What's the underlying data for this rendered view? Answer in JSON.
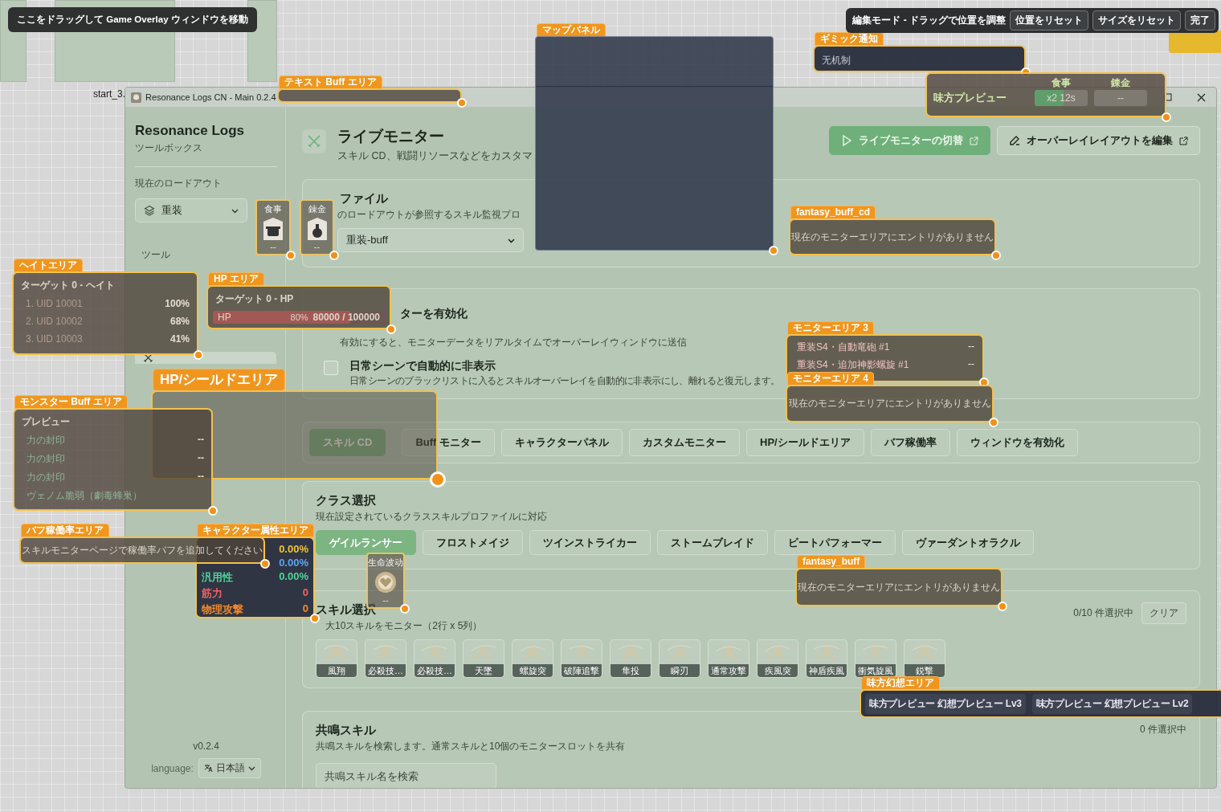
{
  "desktop": {
    "hint": "ここをドラッグして Game Overlay ウィンドウを移動",
    "thumbnail_label": "start_3."
  },
  "edit_bar": {
    "label": "編集モード - ドラッグで位置を調整",
    "buttons": [
      "位置をリセット",
      "サイズをリセット",
      "完了"
    ]
  },
  "window": {
    "title": "Resonance Logs CN - Main 0.2.4"
  },
  "sidebar": {
    "app_name": "Resonance Logs",
    "subtitle": "ツールボックス",
    "loadout_label": "現在のロードアウト",
    "loadout": "重装",
    "section": "ツール",
    "active_item": {
      "selected": true
    },
    "version": "v0.2.4",
    "language_label": "language:",
    "language": "日本語"
  },
  "header": {
    "title": "ライブモニター",
    "subtitle": "スキル CD、戦闘リソースなどをカスタマ",
    "buttons": [
      {
        "label": "ライブモニターの切替",
        "kind": "primary"
      },
      {
        "label": "オーバーレイレイアウトを編集",
        "kind": "secondary"
      }
    ]
  },
  "profile": {
    "title": "ファイル",
    "description": "のロードアウトが参照するスキル監視プロ",
    "selected": "重装-buff"
  },
  "enable_monitor": {
    "title": "ターを有効化",
    "description": "有効にすると、モニターデータをリアルタイムでオーバーレイウィンドウに送信"
  },
  "auto_hide": {
    "title": "日常シーンで自動的に非表示",
    "description": "日常シーンのブラックリストに入るとスキルオーバーレイを自動的に非表示にし、離れると復元します。",
    "checked": false
  },
  "tabs": [
    {
      "label": "スキル CD",
      "selected": true
    },
    {
      "label": "Buff モニター",
      "selected": false
    },
    {
      "label": "キャラクターパネル",
      "selected": false
    },
    {
      "label": "カスタムモニター",
      "selected": false
    },
    {
      "label": "HP/シールドエリア",
      "selected": false
    },
    {
      "label": "バフ稼働率",
      "selected": false
    },
    {
      "label": "ウィンドウを有効化",
      "selected": false
    }
  ],
  "class_select": {
    "title": "クラス選択",
    "description": "現在設定されているクラススキルプロファイルに対応",
    "classes": [
      {
        "label": "ゲイルランサー",
        "selected": true
      },
      {
        "label": "フロストメイジ",
        "selected": false
      },
      {
        "label": "ツインストライカー",
        "selected": false
      },
      {
        "label": "ストームブレイド",
        "selected": false
      },
      {
        "label": "ビートパフォーマー",
        "selected": false
      },
      {
        "label": "ヴァーダントオラクル",
        "selected": false
      }
    ]
  },
  "skill_select": {
    "title": "スキル選択",
    "description": "大10スキルをモニター（2行 x 5列）",
    "count": "0/10 件選択中",
    "clear": "クリア",
    "skills": [
      "風翔",
      "必殺技…",
      "必殺技…",
      "天墜",
      "螺旋突",
      "破陣追撃",
      "隼投",
      "瞬刃",
      "通常攻撃",
      "疾風突",
      "神盾疾風",
      "衝気旋風",
      "鋭撃"
    ]
  },
  "resonance": {
    "title": "共鳴スキル",
    "description": "共鳴スキルを検索します。通常スキルと10個のモニタースロットを共有",
    "count": "0 件選択中",
    "placeholder": "共鳴スキル名を検索"
  },
  "overlays": [
    {
      "kind": "blank",
      "tag": "テキスト Buff エリア",
      "emphasis": false
    },
    {
      "kind": "map",
      "tag": "マップパネル"
    },
    {
      "kind": "notice",
      "tag": "ギミック通知",
      "text": "无机制"
    },
    {
      "kind": "buff_table",
      "columns": [
        "食事",
        "錬金"
      ],
      "label": "味方プレビュー",
      "cells": [
        {
          "text": "x2 12s",
          "level": 0.55
        },
        {
          "text": "--"
        }
      ]
    },
    {
      "kind": "consumable",
      "label": "食事",
      "value": "--"
    },
    {
      "kind": "consumable",
      "label": "錬金",
      "value": "--"
    },
    {
      "kind": "message",
      "tag": "fantasy_buff_cd",
      "text": "現在のモニターエリアにエントリがありません"
    },
    {
      "kind": "hate",
      "tag": "ヘイトエリア",
      "title": "ターゲット 0 - ヘイト",
      "rows": [
        {
          "label": "1. UID 10001",
          "value": "100%"
        },
        {
          "label": "2. UID 10002",
          "value": "68%"
        },
        {
          "label": "3. UID 10003",
          "value": "41%"
        }
      ]
    },
    {
      "kind": "hp",
      "tag": "HP エリア",
      "title": "ターゲット 0 - HP",
      "bar_label": "HP",
      "percent": "80%",
      "reading": "80000 / 100000",
      "level": 0.8
    },
    {
      "kind": "blank",
      "tag": "HP/シールドエリア",
      "emphasis": true
    },
    {
      "kind": "monster_buff",
      "tag": "モンスター Buff エリア",
      "title": "プレビュー",
      "rows": [
        {
          "label": "力の封印",
          "value": "--"
        },
        {
          "label": "力の封印",
          "value": "--"
        },
        {
          "label": "力の封印",
          "value": "--"
        },
        {
          "label": "ヴェノム脆弱（劇毒蜂巣）"
        }
      ]
    },
    {
      "kind": "list",
      "tag": "モニターエリア 3",
      "rows": [
        {
          "label": "重装S4・自動竜砲 #1",
          "value": "--"
        },
        {
          "label": "重装S4・追加神影螺旋 #1",
          "value": "--"
        }
      ]
    },
    {
      "kind": "message",
      "tag": "モニターエリア 4",
      "text": "現在のモニターエリアにエントリがありません"
    },
    {
      "kind": "message",
      "tag": "バフ稼働率エリア",
      "text": "スキルモニターページで稼働率バフを追加してください"
    },
    {
      "kind": "attributes",
      "tag": "キャラクター属性エリア",
      "rows": [
        {
          "value": "0.00%",
          "color": "#f2c230"
        },
        {
          "value": "0.00%",
          "color": "#5ea4f2"
        },
        {
          "label": "汎用性",
          "value": "0.00%",
          "color": "#4fd39a"
        },
        {
          "label": "筋力",
          "value": "0",
          "color": "#f06464"
        },
        {
          "label": "物理攻撃",
          "value": "0",
          "color": "#f08a2c"
        }
      ]
    },
    {
      "kind": "consumable",
      "label": "生命波动",
      "value": "--"
    },
    {
      "kind": "message",
      "tag": "fantasy_buff",
      "text": "現在のモニターエリアにエントリがありません"
    },
    {
      "kind": "chips",
      "tag": "味方幻想エリア",
      "items": [
        "味方プレビュー 幻想プレビュー Lv3",
        "味方プレビュー 幻想プレビュー Lv2"
      ]
    }
  ]
}
